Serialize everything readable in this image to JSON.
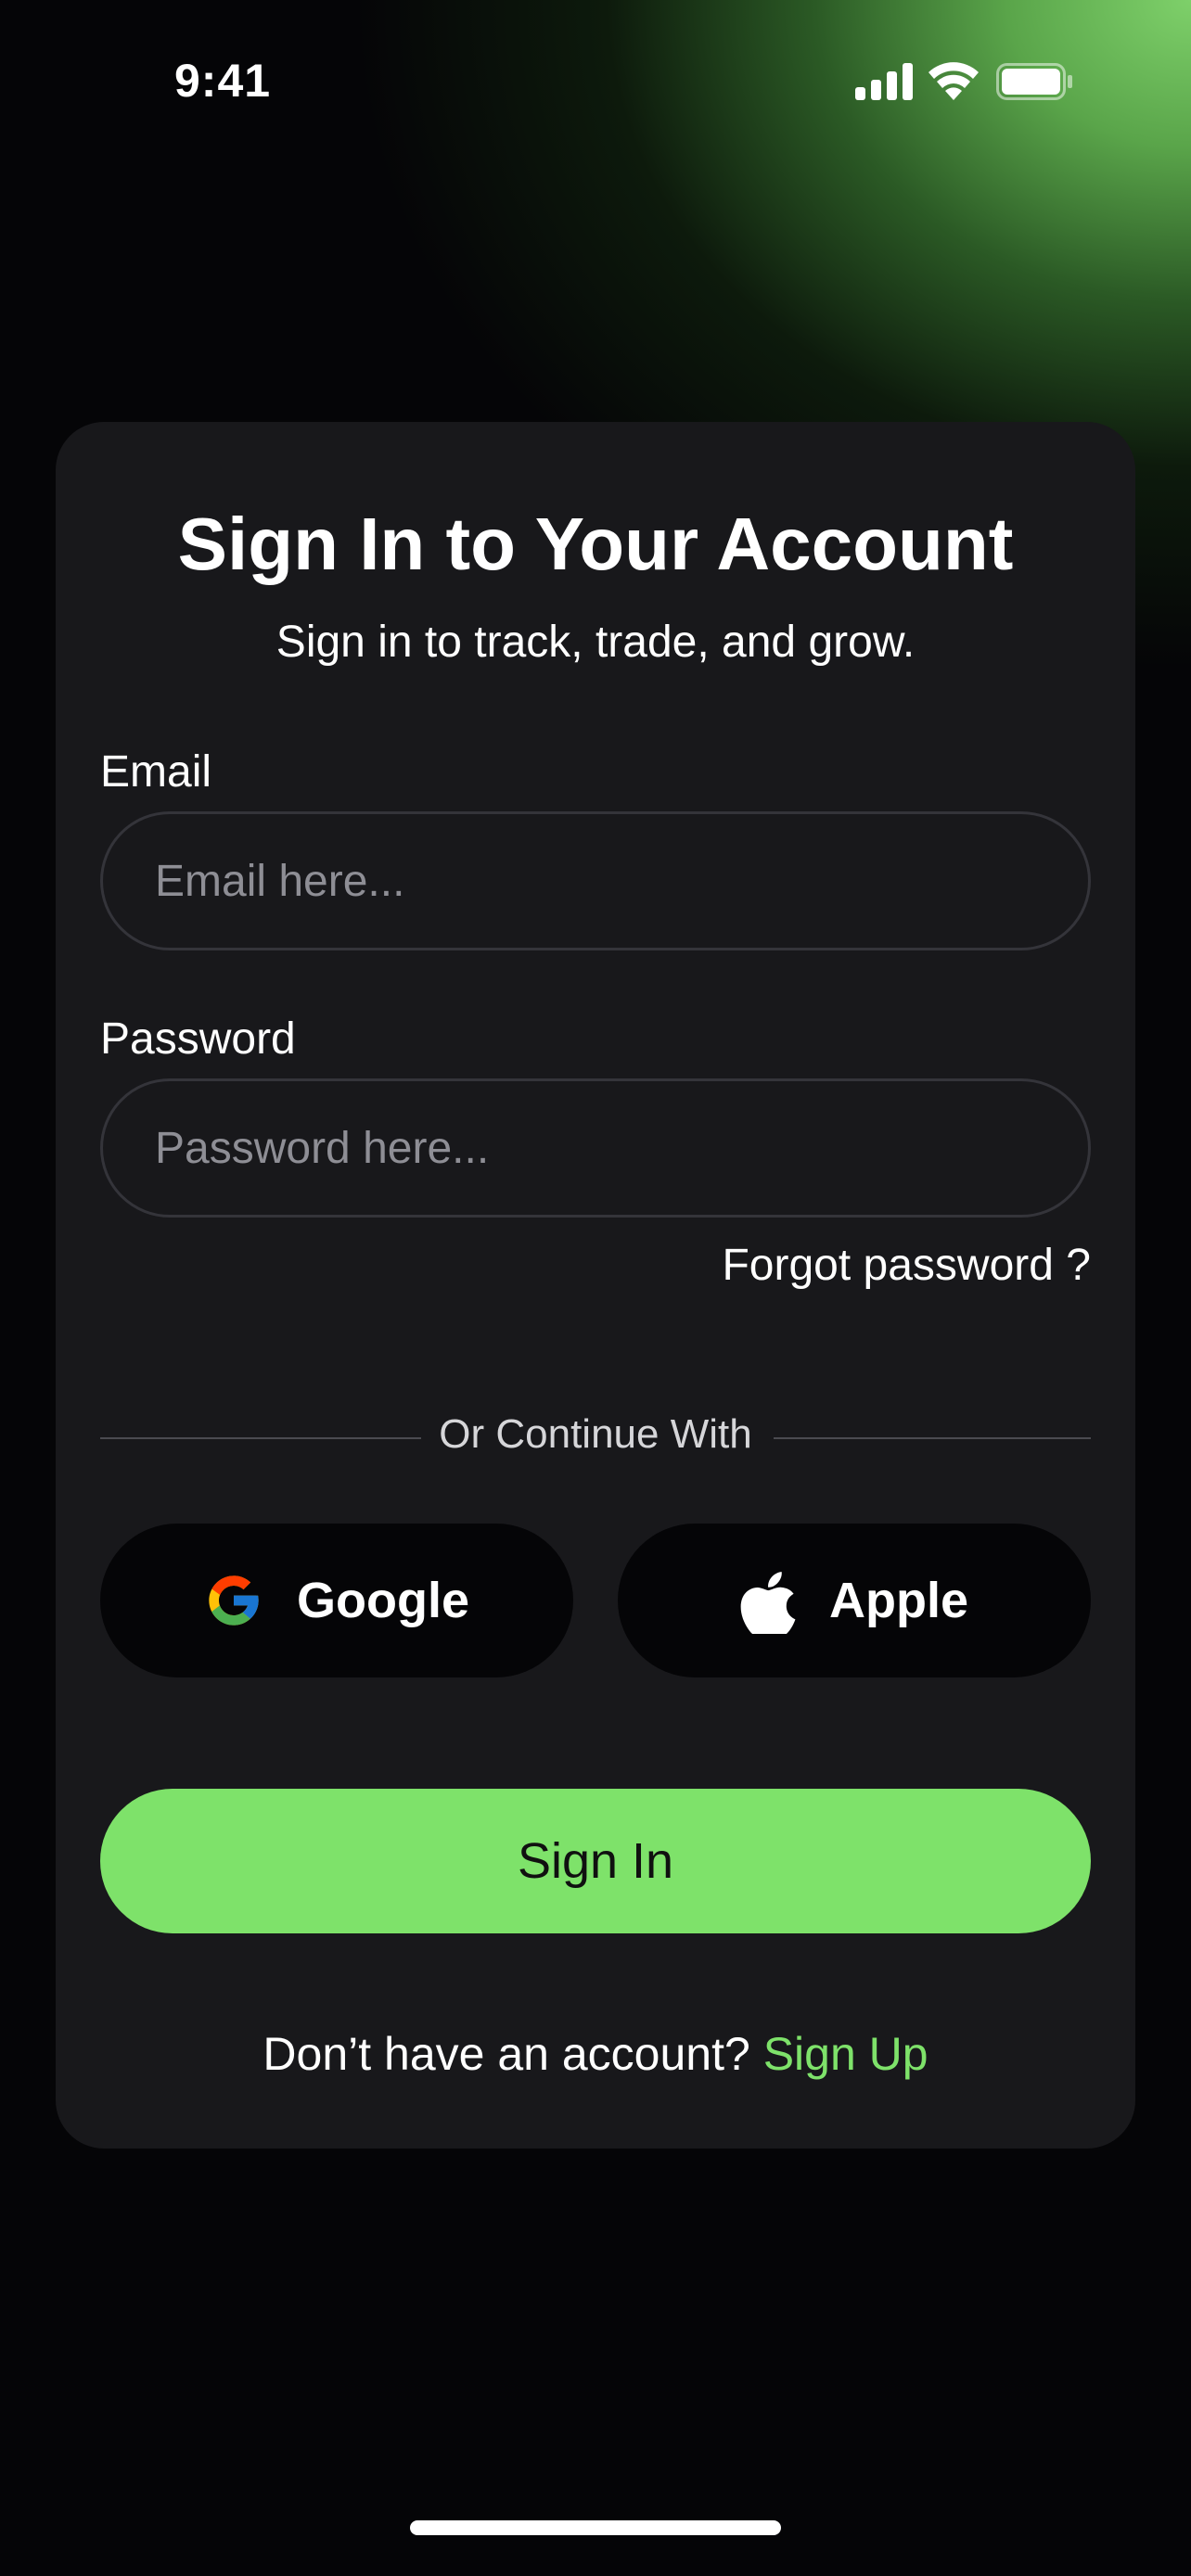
{
  "status_bar": {
    "time": "9:41",
    "icons": [
      "signal-icon",
      "wifi-icon",
      "battery-icon"
    ]
  },
  "card": {
    "title": "Sign In to Your Account",
    "subtitle": "Sign in to track, trade, and grow."
  },
  "form": {
    "email_label": "Email",
    "email_placeholder": "Email here...",
    "password_label": "Password",
    "password_placeholder": "Password here...",
    "forgot_password": "Forgot password ?"
  },
  "divider": {
    "text": "Or Continue With"
  },
  "social": {
    "google_label": "Google",
    "apple_label": "Apple"
  },
  "signin_button": "Sign In",
  "footer": {
    "prompt": "Don’t have an account?",
    "link": "Sign Up"
  },
  "colors": {
    "accent": "#7ee26a",
    "card_bg": "#18181b",
    "page_bg": "#050507"
  }
}
